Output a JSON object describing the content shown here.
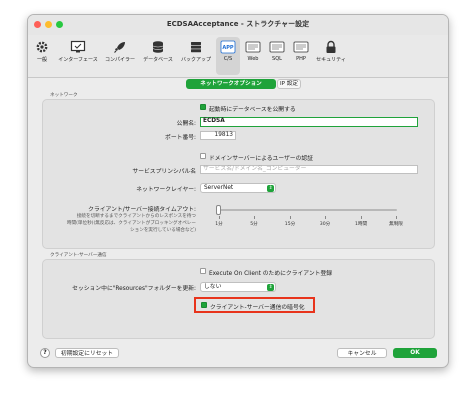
{
  "window": {
    "title": "ECDSAAcceptance - ストラクチャー設定"
  },
  "toolbar": {
    "items": [
      {
        "label": "一般",
        "icon": "gear-icon"
      },
      {
        "label": "インターフェース",
        "icon": "monitor-icon"
      },
      {
        "label": "コンパイラー",
        "icon": "rocket-icon"
      },
      {
        "label": "データベース",
        "icon": "database-icon"
      },
      {
        "label": "バックアップ",
        "icon": "backup-icon"
      },
      {
        "label": "C/S",
        "icon": "app-server-icon"
      },
      {
        "label": "Web",
        "icon": "web-icon"
      },
      {
        "label": "SQL",
        "icon": "sql-icon"
      },
      {
        "label": "PHP",
        "icon": "php-icon"
      },
      {
        "label": "セキュリティ",
        "icon": "lock-icon"
      }
    ],
    "selected": "C/S",
    "app_badge": "APP"
  },
  "tabs": {
    "network_options": "ネットワークオプション",
    "ip_settings": "IP 設定"
  },
  "network": {
    "group_title": "ネットワーク",
    "publish_checkbox": "起動時にデータベースを公開する",
    "publish_checked": true,
    "publish_name_label": "公開名:",
    "publish_name_value": "ECDSA",
    "port_label": "ポート番号:",
    "port_value": "19813",
    "domain_auth_checkbox": "ドメインサーバーによるユーザーの認証",
    "domain_auth_checked": false,
    "spn_label": "サービスプリンシパル名",
    "spn_placeholder": "サービス名/ドメイン名_コンピューター",
    "network_layer_label": "ネットワークレイヤー:",
    "network_layer_value": "ServerNet",
    "timeout_label": "クライアント/サーバー接続タイムアウト:",
    "timeout_desc_1": "接続を切断するまでクライアントからのレスポンスを待つ",
    "timeout_desc_2": "時間(単位秒)(無反応は、クライアントがブロッキングオペレー",
    "timeout_desc_3": "ションを実行している場合など)",
    "timeout_ticks": [
      "1分",
      "5分",
      "15分",
      "30分",
      "1時間",
      "無制限"
    ],
    "timeout_value_index": 0
  },
  "client_server": {
    "group_title": "クライアント-サーバー通信",
    "execute_on_client": "Execute On Client のためにクライアント登録",
    "execute_on_client_checked": false,
    "resources_label": "セッション中に\"Resources\"フォルダーを更新:",
    "resources_value": "しない",
    "encrypt_checkbox": "クライアント-サーバー通信の暗号化",
    "encrypt_checked": true,
    "highlight_color": "#e8341c"
  },
  "footer": {
    "help": "?",
    "reset": "初期設定にリセット",
    "cancel": "キャンセル",
    "ok": "OK"
  },
  "colors": {
    "accent": "#1fa33a",
    "close": "#fe5f57",
    "minimize": "#febc2e",
    "zoom": "#28c840"
  }
}
